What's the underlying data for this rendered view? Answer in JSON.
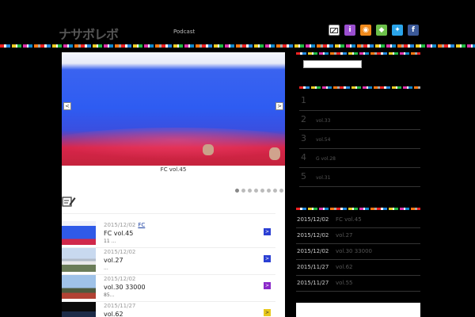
{
  "header": {
    "logo": "ナサボレボ",
    "nav": [
      "Podcast"
    ],
    "social_icons": [
      "mail-icon",
      "info-icon",
      "rss-icon",
      "feedly-icon",
      "twitter-icon",
      "facebook-icon"
    ],
    "social_glyphs": {
      "info": "i",
      "rss": "◉",
      "feedly": "◆",
      "twitter": "✦",
      "facebook": "f"
    }
  },
  "slider": {
    "caption": "FC vol.45",
    "prev_label": "<",
    "next_label": ">",
    "dot_count": 8,
    "active_dot": 0
  },
  "posts": [
    {
      "date": "2015/12/02",
      "category": "FC",
      "title": "FC vol.45",
      "excerpt": "11 ...",
      "go": ">",
      "thumb": "flag"
    },
    {
      "date": "2015/12/02",
      "category": "",
      "title": "vol.27",
      "excerpt": "...",
      "go": ">",
      "thumb": "sky"
    },
    {
      "date": "2015/12/02",
      "category": "",
      "title": "vol.30          33000",
      "excerpt": "85...",
      "go": ">",
      "thumb": "tower"
    },
    {
      "date": "2015/11/27",
      "category": "",
      "title": "vol.62",
      "excerpt": "",
      "go": ">",
      "thumb": "dark"
    }
  ],
  "sidebar": {
    "ranking": [
      {
        "rank": "1",
        "title": ""
      },
      {
        "rank": "2",
        "title": "vol.33"
      },
      {
        "rank": "3",
        "title": "vol.54"
      },
      {
        "rank": "4",
        "title": "G vol.28"
      },
      {
        "rank": "5",
        "title": "vol.31"
      }
    ],
    "recent": [
      {
        "date": "2015/12/02",
        "title": "FC vol.45"
      },
      {
        "date": "2015/12/02",
        "title": "vol.27"
      },
      {
        "date": "2015/12/02",
        "title": "vol.30          33000"
      },
      {
        "date": "2015/11/27",
        "title": "vol.62"
      },
      {
        "date": "2015/11/27",
        "title": "vol.55"
      }
    ]
  },
  "colors": {
    "background": "#000000",
    "accent_blue": "#2b3fd3",
    "accent_purple": "#8a29c9",
    "accent_yellow": "#e8c81c"
  }
}
